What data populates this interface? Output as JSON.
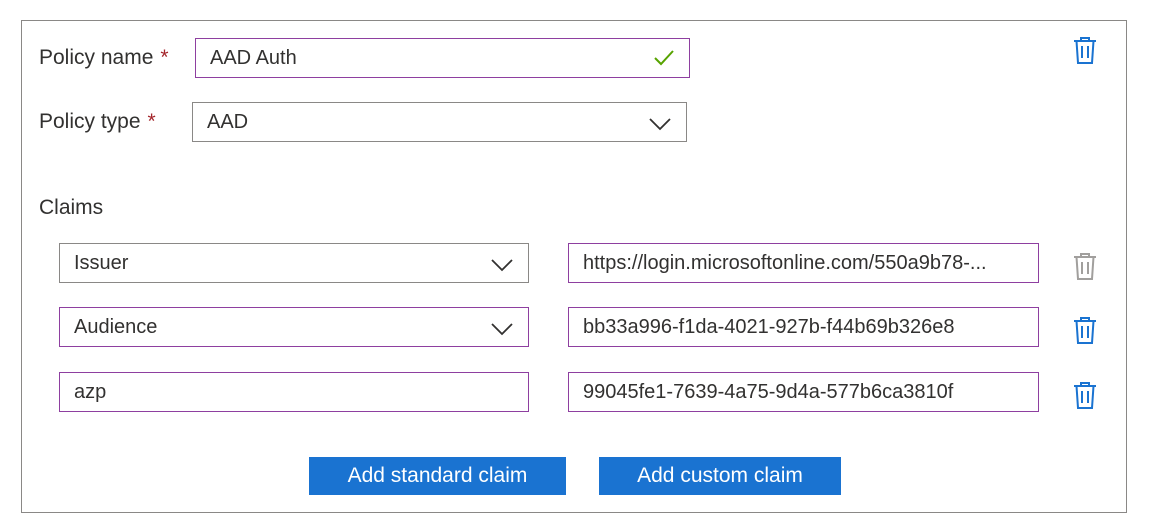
{
  "policy": {
    "name_label": "Policy name",
    "name_value": "AAD Auth",
    "type_label": "Policy type",
    "type_value": "AAD",
    "required_mark": "*"
  },
  "claims": {
    "title": "Claims",
    "rows": [
      {
        "name": "Issuer",
        "value": "https://login.microsoftonline.com/550a9b78-...",
        "delete_enabled": false
      },
      {
        "name": "Audience",
        "value": "bb33a996-f1da-4021-927b-f44b69b326e8",
        "delete_enabled": true
      },
      {
        "name": "azp",
        "value": "99045fe1-7639-4a75-9d4a-577b6ca3810f",
        "delete_enabled": true
      }
    ]
  },
  "buttons": {
    "add_standard": "Add standard claim",
    "add_custom": "Add custom claim"
  },
  "colors": {
    "accent": "#1a73d1",
    "field_border_active": "#8e3fa0",
    "field_border": "#8a8886",
    "required": "#a4262c",
    "check": "#57a300",
    "trash_enabled": "#1a73d1",
    "trash_disabled": "#a19f9d"
  },
  "icons": {
    "delete": "trash-icon",
    "valid": "checkmark-icon",
    "dropdown": "chevron-down-icon"
  }
}
